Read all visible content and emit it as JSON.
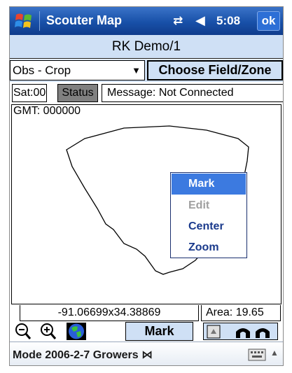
{
  "titlebar": {
    "app_title": "Scouter Map",
    "connection_icon": "⇄",
    "volume_icon": "◀",
    "time": "5:08",
    "ok_label": "ok"
  },
  "header": {
    "title": "RK Demo/1"
  },
  "controls": {
    "crop_value": "Obs - Crop",
    "choose_label": "Choose Field/Zone"
  },
  "status": {
    "sat": "Sat:00",
    "status_label": "Status",
    "message": "Message: Not Connected"
  },
  "map": {
    "gmt": "GMT: 000000",
    "context_menu": [
      {
        "label": "Mark",
        "state": "selected"
      },
      {
        "label": "Edit",
        "state": "disabled"
      },
      {
        "label": "Center",
        "state": "normal"
      },
      {
        "label": "Zoom",
        "state": "normal"
      }
    ]
  },
  "coords": {
    "position": "-91.06699x34.38869",
    "area": "Area: 19.65"
  },
  "toolbar": {
    "mark_label": "Mark"
  },
  "bottombar": {
    "mode_text": "Mode 2006-2-7 Growers"
  },
  "colors": {
    "titlebar": "#1850a8",
    "panel": "#cfe0f5",
    "menu_highlight": "#3c7ae0",
    "status_button": "#808080"
  }
}
